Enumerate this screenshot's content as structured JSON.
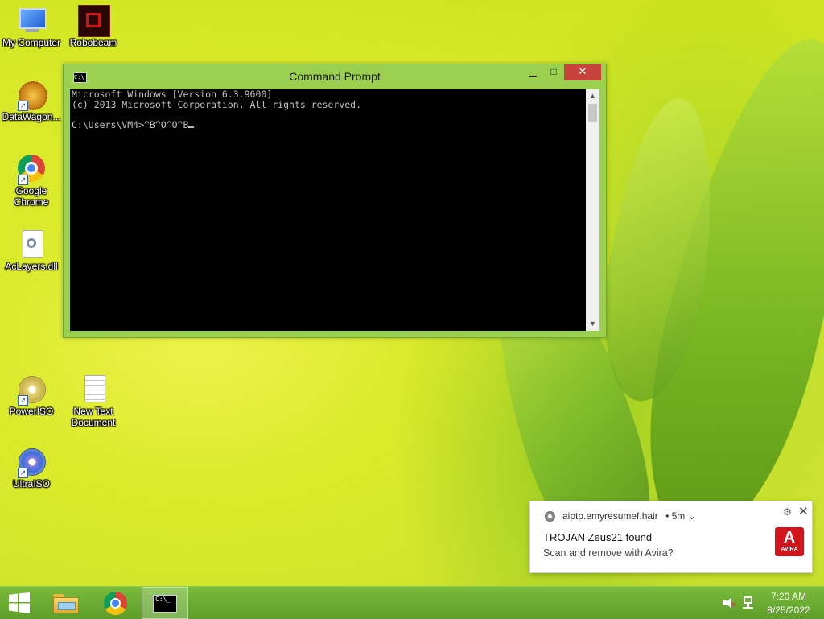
{
  "desktop": {
    "icons": [
      {
        "label": "My Computer"
      },
      {
        "label": "Robobeam"
      },
      {
        "label": "DataWagon..."
      },
      {
        "label": "Google Chrome"
      },
      {
        "label": "AcLayers.dll"
      },
      {
        "label": "PowerISO"
      },
      {
        "label": "New Text Document"
      },
      {
        "label": "UltraISO"
      }
    ]
  },
  "cmd_window": {
    "title": "Command Prompt",
    "icon_text": "C:\\_",
    "lines": [
      "Microsoft Windows [Version 6.3.9600]",
      "(c) 2013 Microsoft Corporation. All rights reserved.",
      "",
      "C:\\Users\\VM4>^B^O^O^B"
    ],
    "minimize_label": "▭",
    "maximize_label": "□",
    "close_label": "✕"
  },
  "notification": {
    "source": "aiptp.emyresumef.hair",
    "age": "• 5m ⌄",
    "title": "TROJAN Zeus21 found",
    "body": "Scan and remove with Avira?",
    "brand_mark": "A",
    "brand_name": "AVIRA",
    "gear_icon": "⚙",
    "close_icon": "✕"
  },
  "taskbar": {
    "time": "7:20 AM",
    "date": "8/25/2022",
    "cmd_icon_text": "C:\\_"
  },
  "colors": {
    "accent_close": "#c7423a",
    "avira_red": "#d2141c",
    "taskbar": "#6aab32"
  }
}
